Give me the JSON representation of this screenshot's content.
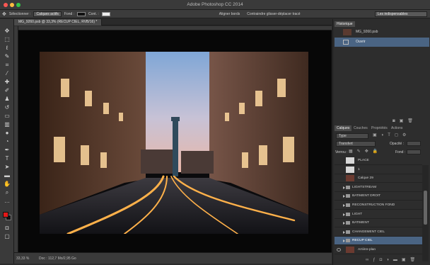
{
  "window": {
    "title": "Adobe Photoshop CC 2014"
  },
  "options": {
    "select_label": "Sélectionner :",
    "select_value": "Calques actifs",
    "fill_label": "Fond :",
    "cont_label": "Cont. :",
    "checkbox_label": "Aligner bords",
    "drag_label": "Contraindre glisser-déplacer tracé",
    "workspace": "Les indispensables"
  },
  "document": {
    "tab_label": "MG_9260.psb @ 33,3% (RECUP CIEL, RVB/16) *"
  },
  "status": {
    "zoom": "33,33 %",
    "doc": "Doc : 112,7 Mo/2,95 Go"
  },
  "history": {
    "tab": "Historique",
    "items": [
      {
        "label": "MG_9260.psb"
      },
      {
        "label": "Ouvrir"
      }
    ]
  },
  "layers_panel": {
    "tabs": [
      "Calques",
      "Couches",
      "Propriétés",
      "Actions"
    ],
    "kind": "Type",
    "blend": "Transfert",
    "opacity_label": "Opacité :",
    "fill_label": "Fond :",
    "lock_label": "Verrou :",
    "layers": [
      {
        "name": "PLACE",
        "type": "layer",
        "thumb": "light"
      },
      {
        "name": "1",
        "type": "layer",
        "thumb": "light"
      },
      {
        "name": "Calque 29",
        "type": "layer",
        "thumb": "photo"
      },
      {
        "name": "LIGHTSTREAM",
        "type": "group"
      },
      {
        "name": "BATIMENT DROIT",
        "type": "group"
      },
      {
        "name": "RECONSTRUCTION FOND",
        "type": "group"
      },
      {
        "name": "LIGHT",
        "type": "group"
      },
      {
        "name": "BATIMENT",
        "type": "group"
      },
      {
        "name": "CHANGEMENT CIEL",
        "type": "group"
      },
      {
        "name": "RECUP CIEL",
        "type": "group",
        "selected": true
      },
      {
        "name": "Arrière-plan",
        "type": "layer",
        "thumb": "photo"
      }
    ]
  }
}
